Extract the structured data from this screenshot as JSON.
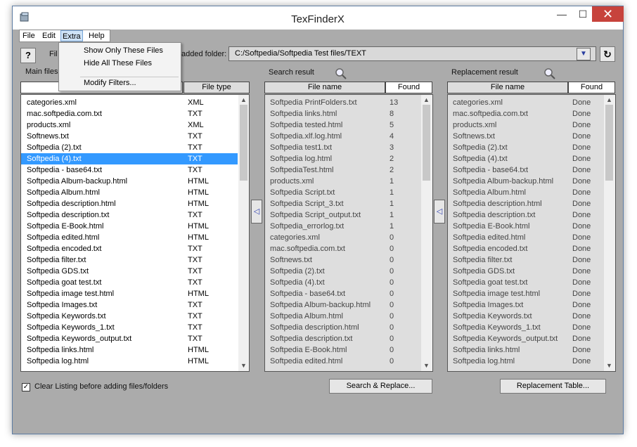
{
  "window": {
    "title": "TexFinderX",
    "minimize": "—",
    "maximize": "☐",
    "close": "✕"
  },
  "menu": {
    "file": "File",
    "edit": "Edit",
    "extra": "Extra",
    "help": "Help"
  },
  "extra_menu": {
    "show_only": "Show Only These Files",
    "hide_all": "Hide All These Files",
    "modify_filters": "Modify Filters..."
  },
  "toolbar": {
    "help_label": "?",
    "fil_fragment": "Fil",
    "added_folder_label": "added folder:",
    "folder_path": "C:/Softpedia/Softpedia Test files/TEXT",
    "refresh": "↻",
    "dropdown_arrow": "▼"
  },
  "main_files": {
    "label": "Main files",
    "col_type": "File type",
    "rows": [
      [
        "categories.xml",
        "XML"
      ],
      [
        "mac.softpedia.com.txt",
        "TXT"
      ],
      [
        "products.xml",
        "XML"
      ],
      [
        "Softnews.txt",
        "TXT"
      ],
      [
        "Softpedia (2).txt",
        "TXT"
      ],
      [
        "Softpedia (4).txt",
        "TXT"
      ],
      [
        "Softpedia - base64.txt",
        "TXT"
      ],
      [
        "Softpedia Album-backup.html",
        "HTML"
      ],
      [
        "Softpedia Album.html",
        "HTML"
      ],
      [
        "Softpedia description.html",
        "HTML"
      ],
      [
        "Softpedia description.txt",
        "TXT"
      ],
      [
        "Softpedia E-Book.html",
        "HTML"
      ],
      [
        "Softpedia edited.html",
        "HTML"
      ],
      [
        "Softpedia encoded.txt",
        "TXT"
      ],
      [
        "Softpedia filter.txt",
        "TXT"
      ],
      [
        "Softpedia GDS.txt",
        "TXT"
      ],
      [
        "Softpedia goat test.txt",
        "TXT"
      ],
      [
        "Softpedia image test.html",
        "HTML"
      ],
      [
        "Softpedia Images.txt",
        "TXT"
      ],
      [
        "Softpedia Keywords.txt",
        "TXT"
      ],
      [
        "Softpedia Keywords_1.txt",
        "TXT"
      ],
      [
        "Softpedia Keywords_output.txt",
        "TXT"
      ],
      [
        "Softpedia links.html",
        "HTML"
      ],
      [
        "Softpedia log.html",
        "HTML"
      ]
    ],
    "selected_index": 5
  },
  "search_result": {
    "label": "Search result",
    "col_name": "File name",
    "col_found": "Found",
    "rows": [
      [
        "Softpedia PrintFolders.txt",
        "13"
      ],
      [
        "Softpedia links.html",
        "8"
      ],
      [
        "Softpedia tested.html",
        "5"
      ],
      [
        "Softpedia.xlf.log.html",
        "4"
      ],
      [
        "Softpedia test1.txt",
        "3"
      ],
      [
        "Softpedia log.html",
        "2"
      ],
      [
        "SoftpediaTest.html",
        "2"
      ],
      [
        "products.xml",
        "1"
      ],
      [
        "Softpedia Script.txt",
        "1"
      ],
      [
        "Softpedia Script_3.txt",
        "1"
      ],
      [
        "Softpedia Script_output.txt",
        "1"
      ],
      [
        "Softpedia_errorlog.txt",
        "1"
      ],
      [
        "categories.xml",
        "0"
      ],
      [
        "mac.softpedia.com.txt",
        "0"
      ],
      [
        "Softnews.txt",
        "0"
      ],
      [
        "Softpedia (2).txt",
        "0"
      ],
      [
        "Softpedia (4).txt",
        "0"
      ],
      [
        "Softpedia - base64.txt",
        "0"
      ],
      [
        "Softpedia Album-backup.html",
        "0"
      ],
      [
        "Softpedia Album.html",
        "0"
      ],
      [
        "Softpedia description.html",
        "0"
      ],
      [
        "Softpedia description.txt",
        "0"
      ],
      [
        "Softpedia E-Book.html",
        "0"
      ],
      [
        "Softpedia edited.html",
        "0"
      ]
    ]
  },
  "replacement_result": {
    "label": "Replacement result",
    "col_name": "File name",
    "col_found": "Found",
    "rows": [
      [
        "categories.xml",
        "Done"
      ],
      [
        "mac.softpedia.com.txt",
        "Done"
      ],
      [
        "products.xml",
        "Done"
      ],
      [
        "Softnews.txt",
        "Done"
      ],
      [
        "Softpedia (2).txt",
        "Done"
      ],
      [
        "Softpedia (4).txt",
        "Done"
      ],
      [
        "Softpedia - base64.txt",
        "Done"
      ],
      [
        "Softpedia Album-backup.html",
        "Done"
      ],
      [
        "Softpedia Album.html",
        "Done"
      ],
      [
        "Softpedia description.html",
        "Done"
      ],
      [
        "Softpedia description.txt",
        "Done"
      ],
      [
        "Softpedia E-Book.html",
        "Done"
      ],
      [
        "Softpedia edited.html",
        "Done"
      ],
      [
        "Softpedia encoded.txt",
        "Done"
      ],
      [
        "Softpedia filter.txt",
        "Done"
      ],
      [
        "Softpedia GDS.txt",
        "Done"
      ],
      [
        "Softpedia goat test.txt",
        "Done"
      ],
      [
        "Softpedia image test.html",
        "Done"
      ],
      [
        "Softpedia Images.txt",
        "Done"
      ],
      [
        "Softpedia Keywords.txt",
        "Done"
      ],
      [
        "Softpedia Keywords_1.txt",
        "Done"
      ],
      [
        "Softpedia Keywords_output.txt",
        "Done"
      ],
      [
        "Softpedia links.html",
        "Done"
      ],
      [
        "Softpedia log.html",
        "Done"
      ]
    ]
  },
  "bottom": {
    "clear_listing_label": "Clear Listing before adding files/folders",
    "clear_listing_checked": true,
    "search_replace_button": "Search & Replace...",
    "replacement_table_button": "Replacement Table..."
  },
  "icons": {
    "search": "magnifier-icon",
    "move_left": "◁"
  }
}
